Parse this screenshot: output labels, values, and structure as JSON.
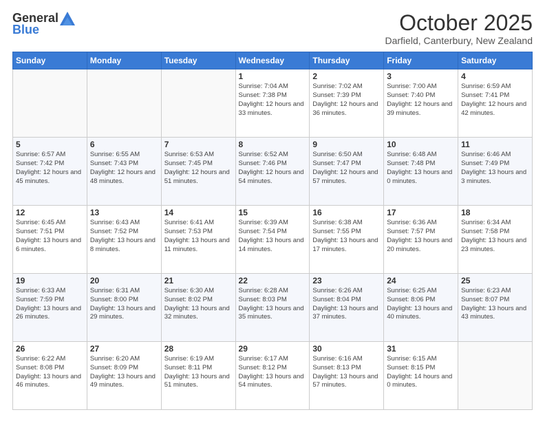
{
  "header": {
    "logo_general": "General",
    "logo_blue": "Blue",
    "month": "October 2025",
    "location": "Darfield, Canterbury, New Zealand"
  },
  "weekdays": [
    "Sunday",
    "Monday",
    "Tuesday",
    "Wednesday",
    "Thursday",
    "Friday",
    "Saturday"
  ],
  "weeks": [
    [
      {
        "day": "",
        "sunrise": "",
        "sunset": "",
        "daylight": ""
      },
      {
        "day": "",
        "sunrise": "",
        "sunset": "",
        "daylight": ""
      },
      {
        "day": "",
        "sunrise": "",
        "sunset": "",
        "daylight": ""
      },
      {
        "day": "1",
        "sunrise": "Sunrise: 7:04 AM",
        "sunset": "Sunset: 7:38 PM",
        "daylight": "Daylight: 12 hours and 33 minutes."
      },
      {
        "day": "2",
        "sunrise": "Sunrise: 7:02 AM",
        "sunset": "Sunset: 7:39 PM",
        "daylight": "Daylight: 12 hours and 36 minutes."
      },
      {
        "day": "3",
        "sunrise": "Sunrise: 7:00 AM",
        "sunset": "Sunset: 7:40 PM",
        "daylight": "Daylight: 12 hours and 39 minutes."
      },
      {
        "day": "4",
        "sunrise": "Sunrise: 6:59 AM",
        "sunset": "Sunset: 7:41 PM",
        "daylight": "Daylight: 12 hours and 42 minutes."
      }
    ],
    [
      {
        "day": "5",
        "sunrise": "Sunrise: 6:57 AM",
        "sunset": "Sunset: 7:42 PM",
        "daylight": "Daylight: 12 hours and 45 minutes."
      },
      {
        "day": "6",
        "sunrise": "Sunrise: 6:55 AM",
        "sunset": "Sunset: 7:43 PM",
        "daylight": "Daylight: 12 hours and 48 minutes."
      },
      {
        "day": "7",
        "sunrise": "Sunrise: 6:53 AM",
        "sunset": "Sunset: 7:45 PM",
        "daylight": "Daylight: 12 hours and 51 minutes."
      },
      {
        "day": "8",
        "sunrise": "Sunrise: 6:52 AM",
        "sunset": "Sunset: 7:46 PM",
        "daylight": "Daylight: 12 hours and 54 minutes."
      },
      {
        "day": "9",
        "sunrise": "Sunrise: 6:50 AM",
        "sunset": "Sunset: 7:47 PM",
        "daylight": "Daylight: 12 hours and 57 minutes."
      },
      {
        "day": "10",
        "sunrise": "Sunrise: 6:48 AM",
        "sunset": "Sunset: 7:48 PM",
        "daylight": "Daylight: 13 hours and 0 minutes."
      },
      {
        "day": "11",
        "sunrise": "Sunrise: 6:46 AM",
        "sunset": "Sunset: 7:49 PM",
        "daylight": "Daylight: 13 hours and 3 minutes."
      }
    ],
    [
      {
        "day": "12",
        "sunrise": "Sunrise: 6:45 AM",
        "sunset": "Sunset: 7:51 PM",
        "daylight": "Daylight: 13 hours and 6 minutes."
      },
      {
        "day": "13",
        "sunrise": "Sunrise: 6:43 AM",
        "sunset": "Sunset: 7:52 PM",
        "daylight": "Daylight: 13 hours and 8 minutes."
      },
      {
        "day": "14",
        "sunrise": "Sunrise: 6:41 AM",
        "sunset": "Sunset: 7:53 PM",
        "daylight": "Daylight: 13 hours and 11 minutes."
      },
      {
        "day": "15",
        "sunrise": "Sunrise: 6:39 AM",
        "sunset": "Sunset: 7:54 PM",
        "daylight": "Daylight: 13 hours and 14 minutes."
      },
      {
        "day": "16",
        "sunrise": "Sunrise: 6:38 AM",
        "sunset": "Sunset: 7:55 PM",
        "daylight": "Daylight: 13 hours and 17 minutes."
      },
      {
        "day": "17",
        "sunrise": "Sunrise: 6:36 AM",
        "sunset": "Sunset: 7:57 PM",
        "daylight": "Daylight: 13 hours and 20 minutes."
      },
      {
        "day": "18",
        "sunrise": "Sunrise: 6:34 AM",
        "sunset": "Sunset: 7:58 PM",
        "daylight": "Daylight: 13 hours and 23 minutes."
      }
    ],
    [
      {
        "day": "19",
        "sunrise": "Sunrise: 6:33 AM",
        "sunset": "Sunset: 7:59 PM",
        "daylight": "Daylight: 13 hours and 26 minutes."
      },
      {
        "day": "20",
        "sunrise": "Sunrise: 6:31 AM",
        "sunset": "Sunset: 8:00 PM",
        "daylight": "Daylight: 13 hours and 29 minutes."
      },
      {
        "day": "21",
        "sunrise": "Sunrise: 6:30 AM",
        "sunset": "Sunset: 8:02 PM",
        "daylight": "Daylight: 13 hours and 32 minutes."
      },
      {
        "day": "22",
        "sunrise": "Sunrise: 6:28 AM",
        "sunset": "Sunset: 8:03 PM",
        "daylight": "Daylight: 13 hours and 35 minutes."
      },
      {
        "day": "23",
        "sunrise": "Sunrise: 6:26 AM",
        "sunset": "Sunset: 8:04 PM",
        "daylight": "Daylight: 13 hours and 37 minutes."
      },
      {
        "day": "24",
        "sunrise": "Sunrise: 6:25 AM",
        "sunset": "Sunset: 8:06 PM",
        "daylight": "Daylight: 13 hours and 40 minutes."
      },
      {
        "day": "25",
        "sunrise": "Sunrise: 6:23 AM",
        "sunset": "Sunset: 8:07 PM",
        "daylight": "Daylight: 13 hours and 43 minutes."
      }
    ],
    [
      {
        "day": "26",
        "sunrise": "Sunrise: 6:22 AM",
        "sunset": "Sunset: 8:08 PM",
        "daylight": "Daylight: 13 hours and 46 minutes."
      },
      {
        "day": "27",
        "sunrise": "Sunrise: 6:20 AM",
        "sunset": "Sunset: 8:09 PM",
        "daylight": "Daylight: 13 hours and 49 minutes."
      },
      {
        "day": "28",
        "sunrise": "Sunrise: 6:19 AM",
        "sunset": "Sunset: 8:11 PM",
        "daylight": "Daylight: 13 hours and 51 minutes."
      },
      {
        "day": "29",
        "sunrise": "Sunrise: 6:17 AM",
        "sunset": "Sunset: 8:12 PM",
        "daylight": "Daylight: 13 hours and 54 minutes."
      },
      {
        "day": "30",
        "sunrise": "Sunrise: 6:16 AM",
        "sunset": "Sunset: 8:13 PM",
        "daylight": "Daylight: 13 hours and 57 minutes."
      },
      {
        "day": "31",
        "sunrise": "Sunrise: 6:15 AM",
        "sunset": "Sunset: 8:15 PM",
        "daylight": "Daylight: 14 hours and 0 minutes."
      },
      {
        "day": "",
        "sunrise": "",
        "sunset": "",
        "daylight": ""
      }
    ]
  ]
}
